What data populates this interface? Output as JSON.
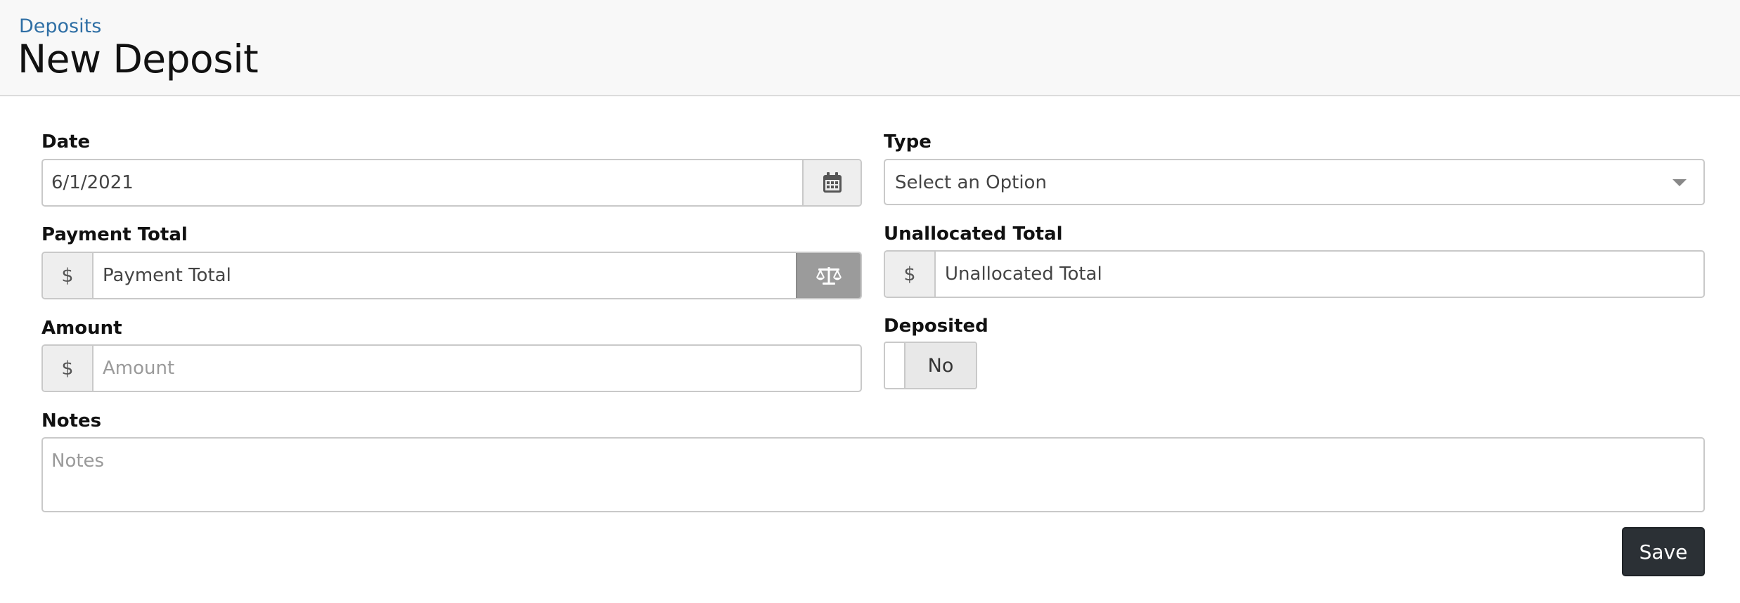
{
  "header": {
    "breadcrumb": "Deposits",
    "title": "New Deposit"
  },
  "form": {
    "date": {
      "label": "Date",
      "value": "6/1/2021",
      "button_icon": "calendar-icon"
    },
    "type": {
      "label": "Type",
      "selected": "Select an Option",
      "icon": "caret-down-icon"
    },
    "payment_total": {
      "label": "Payment Total",
      "prefix": "$",
      "value": "Payment Total",
      "button_icon": "balance-scale-icon"
    },
    "unallocated_total": {
      "label": "Unallocated Total",
      "prefix": "$",
      "value": "Unallocated Total"
    },
    "amount": {
      "label": "Amount",
      "prefix": "$",
      "placeholder": "Amount"
    },
    "deposited": {
      "label": "Deposited",
      "state_label": "No"
    },
    "notes": {
      "label": "Notes",
      "placeholder": "Notes"
    },
    "save_label": "Save"
  },
  "colors": {
    "link": "#2f6fa5",
    "header_bg": "#f8f8f8",
    "save_bg": "#2b3035",
    "scale_button_bg": "#9b9b9b"
  }
}
